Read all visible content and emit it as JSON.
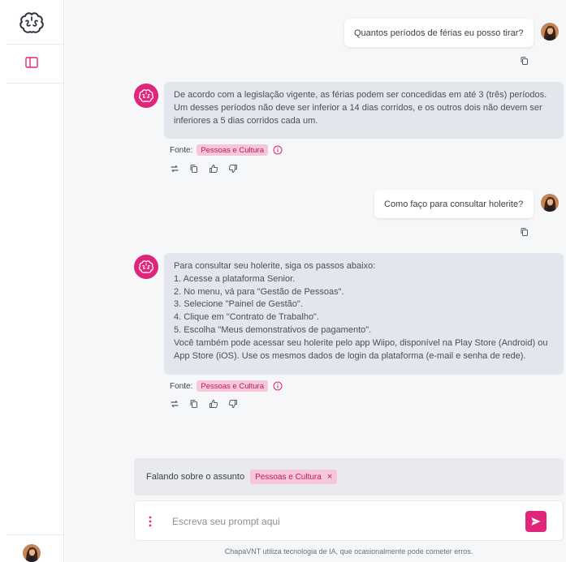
{
  "conversation": [
    {
      "role": "user",
      "text": "Quantos períodos de férias eu posso tirar?"
    },
    {
      "role": "assistant",
      "lines": [
        "De acordo com a legislação vigente, as férias podem ser concedidas em até 3 (três) períodos.",
        "Um desses períodos não deve ser inferior a 14 dias corridos, e os outros dois não devem ser",
        "inferiores a 5 dias corridos cada um."
      ],
      "source_label": "Fonte:",
      "source": "Pessoas e Cultura"
    },
    {
      "role": "user",
      "text": "Como faço para consultar holerite?"
    },
    {
      "role": "assistant",
      "lines": [
        "Para consultar seu holerite, siga os passos abaixo:",
        "1. Acesse a plataforma Senior.",
        "2. No menu, vá para \"Gestão de Pessoas\".",
        "3. Selecione \"Painel de Gestão\".",
        "4. Clique em \"Contrato de Trabalho\".",
        "5. Escolha \"Meus demonstrativos de pagamento\".",
        "Você também pode acessar seu holerite pelo app Wiipo, disponível na Play Store (Android) ou",
        "App Store (iOS). Use os mesmos dados de login da plataforma (e-mail e senha de rede)."
      ],
      "source_label": "Fonte:",
      "source": "Pessoas e Cultura"
    }
  ],
  "topic": {
    "label": "Falando sobre o assunto",
    "chip": "Pessoas e Cultura",
    "remove": "×"
  },
  "prompt": {
    "placeholder": "Escreva seu prompt aqui"
  },
  "disclaimer": "ChapaVNT utiliza tecnologia de IA, que ocasionalmente pode cometer erros.",
  "colors": {
    "accent": "#e0267a",
    "chip_bg": "#f5c7d8",
    "bot_bubble": "#e3e6ed",
    "main_bg": "#f6f7f9"
  },
  "icons": {
    "logo": "brain-logo-icon",
    "sidebar_toggle": "sidebar-toggle-icon",
    "copy": "copy-icon",
    "regenerate": "regenerate-icon",
    "like": "thumbs-up-icon",
    "dislike": "thumbs-down-icon",
    "info": "info-icon",
    "menu": "kebab-menu-icon",
    "send": "send-icon"
  }
}
